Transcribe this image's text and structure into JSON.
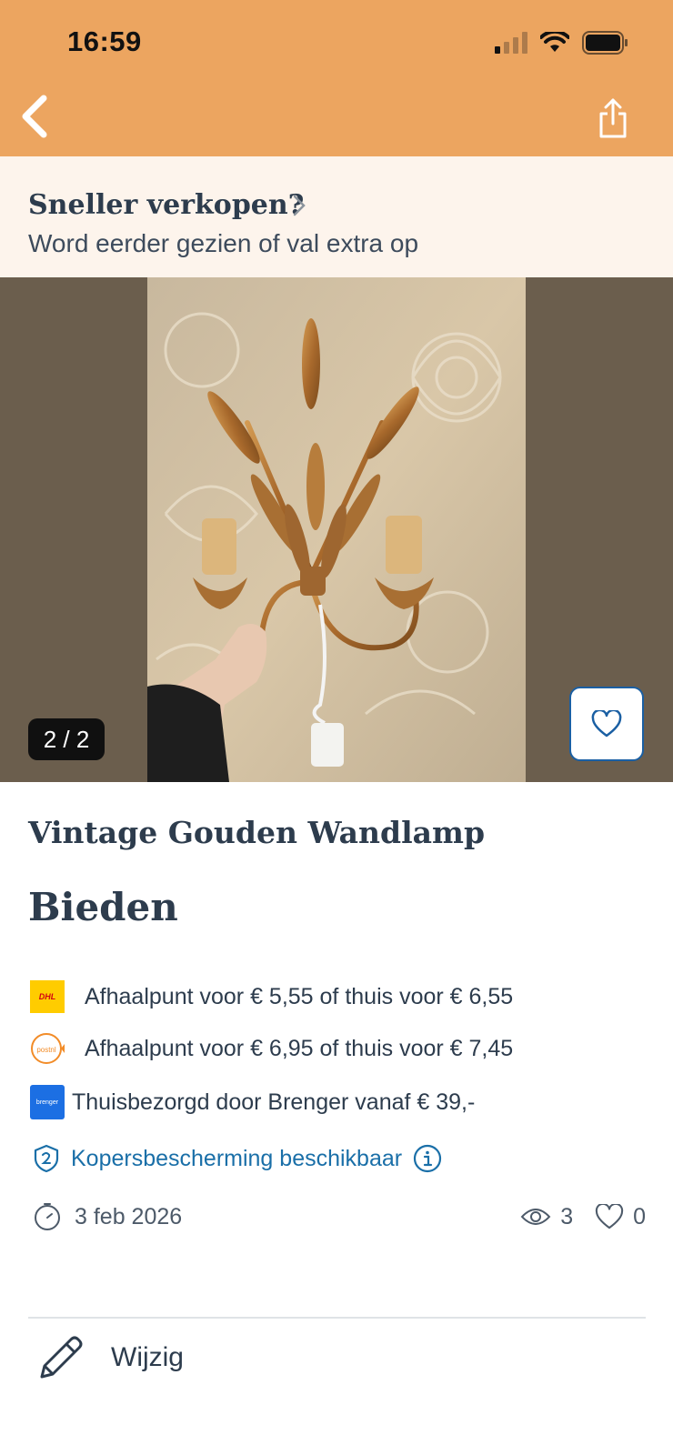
{
  "status_bar": {
    "time": "16:59"
  },
  "header": {
    "back_icon": "chevron-left-icon",
    "share_icon": "share-icon",
    "background": "#eca560"
  },
  "promo": {
    "title": "Sneller verkopen?",
    "subtitle": "Word eerder gezien of val extra op"
  },
  "gallery": {
    "counter": "2 / 2"
  },
  "listing": {
    "title": "Vintage Gouden Wandlamp",
    "price": "Bieden"
  },
  "shipping": [
    {
      "carrier_logo": "DHL",
      "text": "Afhaalpunt voor € 5,55 of thuis voor € 6,55"
    },
    {
      "carrier_logo": "postnl",
      "text": "Afhaalpunt voor € 6,95 of thuis voor € 7,45"
    },
    {
      "carrier_logo": "brenger",
      "text": "Thuisbezorgd door Brenger vanaf € 39,-"
    }
  ],
  "buyer_protection": {
    "label": "Kopersbescherming beschikbaar"
  },
  "meta": {
    "date": "3 feb 2026",
    "views": "3",
    "favorites": "0"
  },
  "actions": {
    "edit_label": "Wijzig"
  },
  "colors": {
    "link": "#1a6fa8",
    "text": "#2d3c4d",
    "promo_bg": "#fdf4ec"
  }
}
